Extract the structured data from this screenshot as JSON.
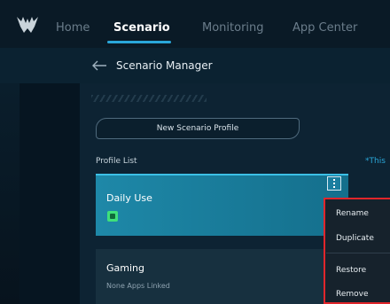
{
  "nav": {
    "items": [
      {
        "label": "Home",
        "active": false
      },
      {
        "label": "Scenario",
        "active": true
      },
      {
        "label": "Monitoring",
        "active": false
      },
      {
        "label": "App Center",
        "active": false
      }
    ]
  },
  "header": {
    "title": "Scenario Manager"
  },
  "main": {
    "new_profile_label": "New Scenario Profile",
    "profile_list_label": "Profile List",
    "note_text": "*This"
  },
  "profiles": [
    {
      "name": "Daily Use",
      "subtitle": "",
      "selected": true
    },
    {
      "name": "Gaming",
      "subtitle": "None Apps Linked",
      "selected": false
    }
  ],
  "context_menu": {
    "items": [
      "Rename",
      "Duplicate",
      "Restore",
      "Remove"
    ]
  },
  "colors": {
    "accent": "#2aa7d9",
    "selected_card": "#1e88a8",
    "highlight_border": "#e0262b"
  }
}
